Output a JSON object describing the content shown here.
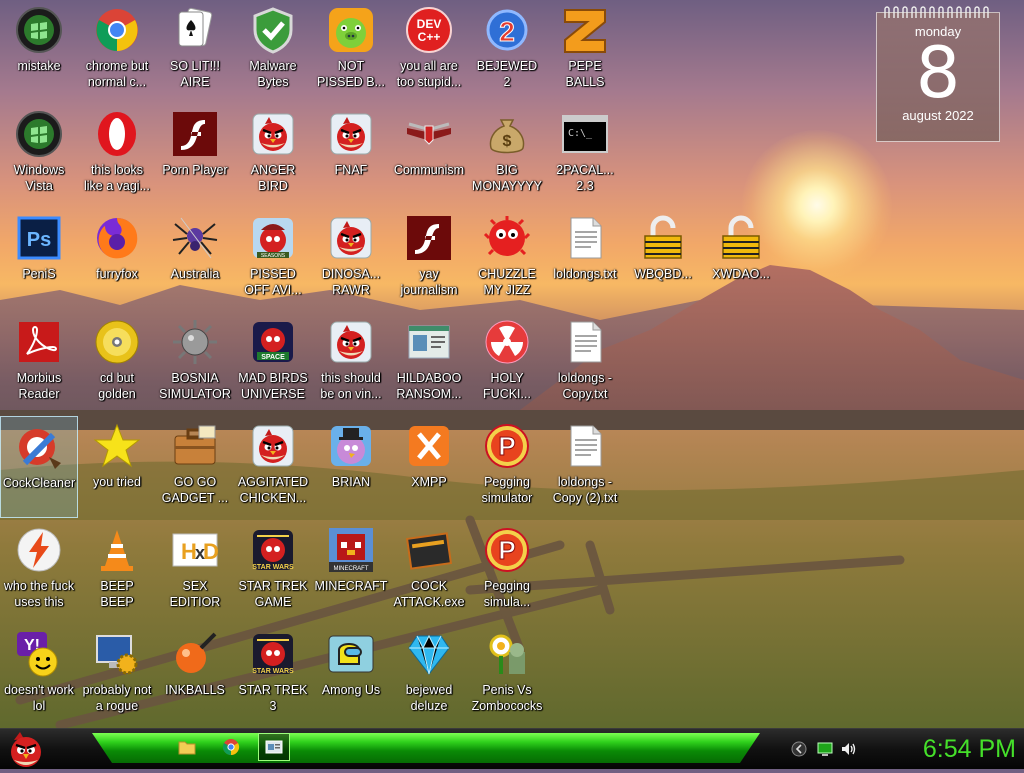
{
  "desktop_icons": [
    {
      "label": "mistake",
      "icon": "green-orb-icon"
    },
    {
      "label": "chrome but\nnormal c...",
      "icon": "chrome-icon"
    },
    {
      "label": "SO LIT!!!\nAIRE",
      "icon": "solitaire-cards-icon"
    },
    {
      "label": "Malware\nBytes",
      "icon": "shield-check-icon"
    },
    {
      "label": "NOT\nPISSED B...",
      "icon": "green-pig-icon"
    },
    {
      "label": "you all are\ntoo stupid...",
      "icon": "devcpp-icon"
    },
    {
      "label": "BEJEWED\n2",
      "icon": "bejeweled-2-icon"
    },
    {
      "label": "PEPE\nBALLS",
      "icon": "z-block-icon"
    },
    {
      "label": "Windows\nVista",
      "icon": "green-orb-icon"
    },
    {
      "label": "this looks\nlike a vagi...",
      "icon": "opera-icon"
    },
    {
      "label": "Porn Player",
      "icon": "flash-icon"
    },
    {
      "label": "ANGER\nBIRD",
      "icon": "angry-bird-icon"
    },
    {
      "label": "FNAF",
      "icon": "angry-bird-icon"
    },
    {
      "label": "Communism",
      "icon": "winged-emblem-icon"
    },
    {
      "label": "BIG\nMONAYYYY",
      "icon": "money-bag-icon"
    },
    {
      "label": "2PACAL...\n2.3",
      "icon": "command-prompt-icon"
    },
    {
      "label": "PeniS",
      "icon": "photoshop-icon"
    },
    {
      "label": "furryfox",
      "icon": "firefox-icon"
    },
    {
      "label": "Australia",
      "icon": "spider-icon"
    },
    {
      "label": "PISSED\nOFF AVI...",
      "icon": "angry-birds-seasons-icon"
    },
    {
      "label": "DINOSA...\nRAWR",
      "icon": "angry-bird-icon"
    },
    {
      "label": "yay\njournalism",
      "icon": "flash-icon"
    },
    {
      "label": "CHUZZLE\nMY JIZZ",
      "icon": "chuzzle-icon"
    },
    {
      "label": "loldongs.txt",
      "icon": "text-file-icon"
    },
    {
      "label": "WBQBD...",
      "icon": "padlock-icon"
    },
    {
      "label": "XWDAO...",
      "icon": "padlock-icon"
    },
    {
      "label": "Morbius\nReader",
      "icon": "pdf-reader-icon"
    },
    {
      "label": "cd but\ngolden",
      "icon": "golden-cd-icon"
    },
    {
      "label": "BOSNIA\nSIMULATOR",
      "icon": "spiked-mine-icon"
    },
    {
      "label": "MAD BIRDS\nUNIVERSE",
      "icon": "angry-birds-space-icon"
    },
    {
      "label": "this should\nbe on vin...",
      "icon": "angry-bird-icon"
    },
    {
      "label": "HILDABOO\nRANSOM...",
      "icon": "window-screen-icon"
    },
    {
      "label": "HOLY\nFUCKI...",
      "icon": "radiation-icon"
    },
    {
      "label": "loldongs -\nCopy.txt",
      "icon": "text-file-icon"
    },
    {
      "label": "CockCleaner",
      "icon": "ccleaner-icon",
      "selected": true
    },
    {
      "label": "you tried",
      "icon": "star-icon"
    },
    {
      "label": "GO GO\nGADGET ...",
      "icon": "briefcase-icon"
    },
    {
      "label": "AGGITATED\nCHICKEN...",
      "icon": "angry-bird-icon"
    },
    {
      "label": "BRIAN",
      "icon": "purple-bird-icon"
    },
    {
      "label": "XMPP",
      "icon": "xampp-icon"
    },
    {
      "label": "Pegging\nsimulator",
      "icon": "peggle-icon"
    },
    {
      "label": "loldongs -\nCopy (2).txt",
      "icon": "text-file-icon"
    },
    {
      "label": "who the fuck\nuses this",
      "icon": "lightning-icon"
    },
    {
      "label": "BEEP\nBEEP",
      "icon": "vlc-cone-icon"
    },
    {
      "label": "SEX\nEDITIOR",
      "icon": "hxd-icon"
    },
    {
      "label": "STAR TREK\nGAME",
      "icon": "star-wars-bird-icon"
    },
    {
      "label": "MINECRAFT",
      "icon": "minecraft-bird-icon"
    },
    {
      "label": "COCK\nATTACK.exe",
      "icon": "cockatrice-icon"
    },
    {
      "label": "Pegging\nsimula...",
      "icon": "peggle-icon"
    },
    {
      "label": "doesn't work\nlol",
      "icon": "yahoo-messenger-icon"
    },
    {
      "label": "probably not\na rogue",
      "icon": "monitor-gears-icon"
    },
    {
      "label": "INKBALLS",
      "icon": "inkball-icon"
    },
    {
      "label": "STAR TREK\n3",
      "icon": "star-wars-bird-icon"
    },
    {
      "label": "Among Us",
      "icon": "among-us-icon"
    },
    {
      "label": "bejewed\ndeluze",
      "icon": "diamond-icon"
    },
    {
      "label": "Penis Vs\nZombococks",
      "icon": "plants-vs-zombies-icon"
    }
  ],
  "calendar": {
    "day": "monday",
    "date": "8",
    "month": "august 2022"
  },
  "taskbar": {
    "start_icon": "angry-bird-start-icon",
    "pinned": [
      {
        "name": "file-explorer-icon"
      },
      {
        "name": "chrome-icon"
      },
      {
        "name": "window-screen-icon"
      }
    ],
    "tray": [
      {
        "name": "chevron-left-icon"
      },
      {
        "name": "network-icon"
      },
      {
        "name": "volume-icon"
      }
    ],
    "clock": "6:54 PM"
  },
  "colors": {
    "taskbar_green": "#2fd11c",
    "clock_green": "#45e02a",
    "selection": "#c8f0ff"
  }
}
